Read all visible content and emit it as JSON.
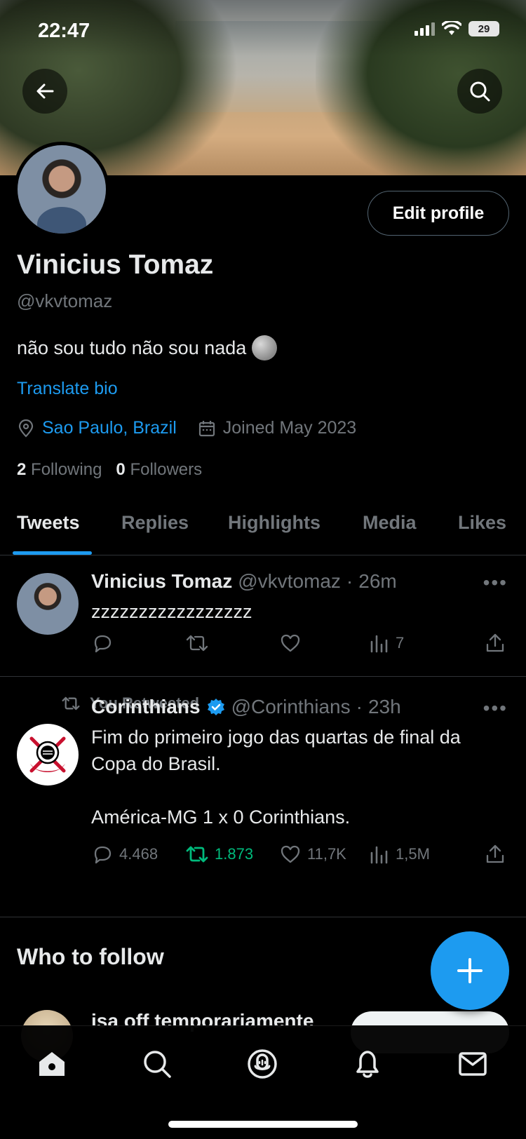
{
  "status_bar": {
    "time": "22:47",
    "battery": "29"
  },
  "profile": {
    "name": "Vinicius Tomaz",
    "handle": "@vkvtomaz",
    "bio": "não sou tudo não sou nada",
    "translate_label": "Translate bio",
    "location": "Sao Paulo, Brazil",
    "joined": "Joined May 2023",
    "following_count": "2",
    "following_label": "Following",
    "followers_count": "0",
    "followers_label": "Followers",
    "edit_button": "Edit profile"
  },
  "tabs": [
    "Tweets",
    "Replies",
    "Highlights",
    "Media",
    "Likes"
  ],
  "tweets": [
    {
      "name": "Vinicius Tomaz",
      "handle": "@vkvtomaz",
      "dot": "·",
      "time": "26m",
      "text": "zzzzzzzzzzzzzzzzz",
      "views": "7",
      "more": "•••"
    },
    {
      "retweet_label": "You Retweeted",
      "name": "Corinthians",
      "handle": "@Corinthians",
      "dot": "·",
      "time": "23h",
      "text_line1": "Fim do primeiro jogo das quartas de final da",
      "text_line2": "Copa do Brasil.",
      "text_line3": "América-MG 1 x 0 Corinthians.",
      "replies": "4.468",
      "retweets": "1.873",
      "likes": "11,7K",
      "views": "1,5M",
      "more": "•••"
    }
  ],
  "who_to_follow": {
    "title": "Who to follow",
    "first_name": "isa off temporariamente"
  },
  "colors": {
    "accent": "#1d9bf0",
    "retweet_green": "#00ba7c",
    "muted": "#71767b"
  },
  "icons": [
    "back-arrow-icon",
    "search-icon",
    "location-pin-icon",
    "calendar-icon",
    "reply-icon",
    "retweet-icon",
    "like-icon",
    "views-icon",
    "share-icon",
    "verified-icon",
    "home-icon",
    "spaces-icon",
    "bell-icon",
    "mail-icon",
    "plus-icon"
  ]
}
